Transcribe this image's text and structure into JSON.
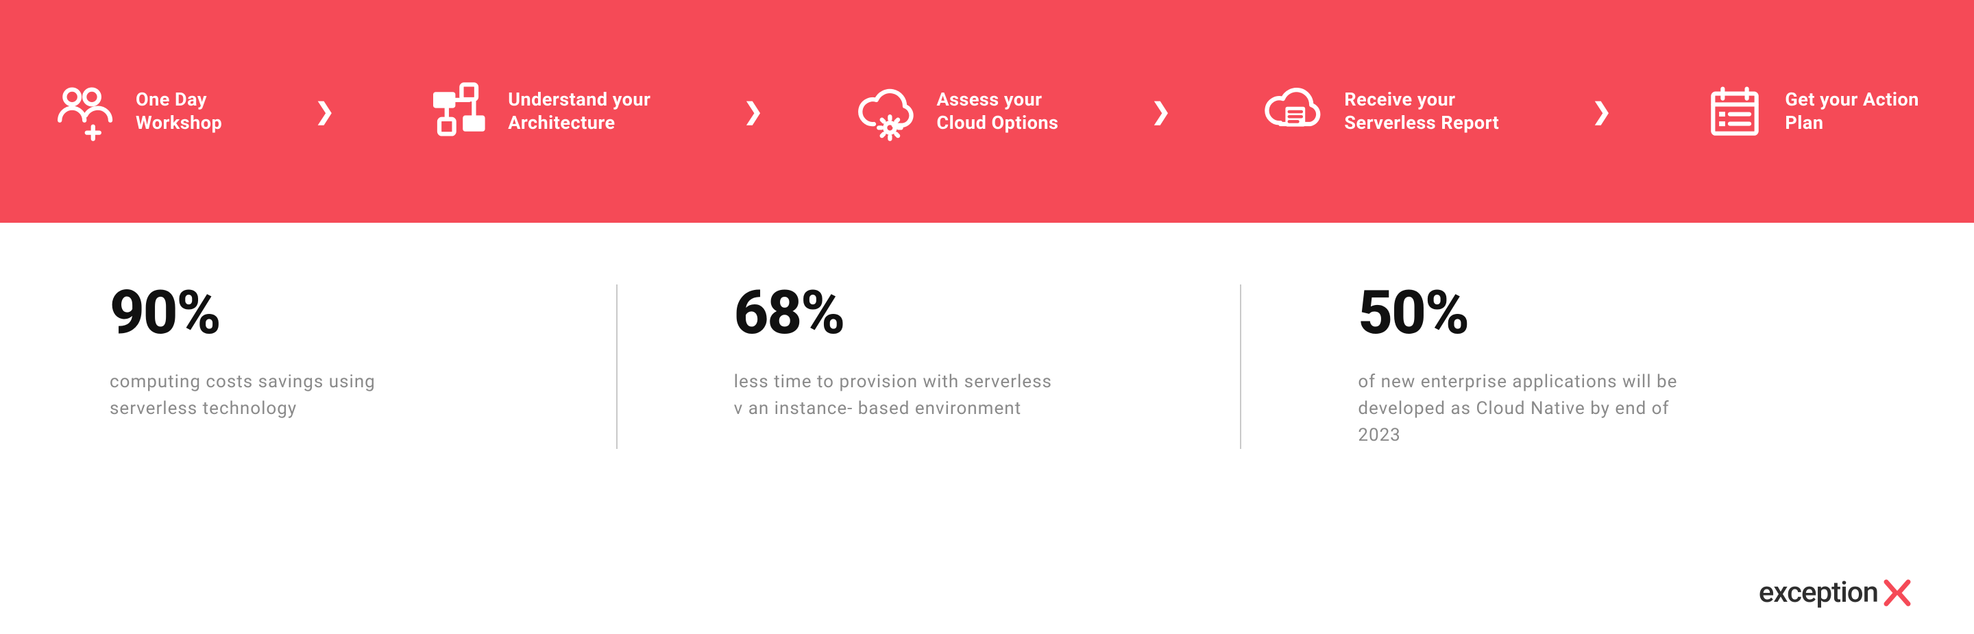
{
  "steps": [
    {
      "label": "One Day\nWorkshop"
    },
    {
      "label": "Understand your\nArchitecture"
    },
    {
      "label": "Assess your\nCloud Options"
    },
    {
      "label": "Receive your\nServerless Report"
    },
    {
      "label": "Get your Action\nPlan"
    }
  ],
  "stats": [
    {
      "value": "90%",
      "desc": "computing costs savings using serverless technology"
    },
    {
      "value": "68%",
      "desc": "less time to provision with serverless v an instance- based environment"
    },
    {
      "value": "50%",
      "desc": "of new enterprise applications will be developed as Cloud Native by end of 2023"
    }
  ],
  "brand": "exception"
}
